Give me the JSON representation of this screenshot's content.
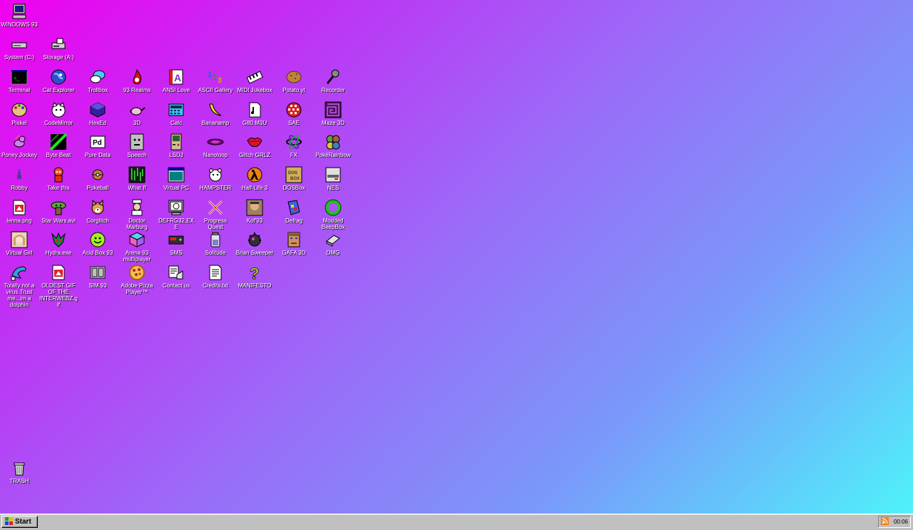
{
  "desktop": {
    "icons": [
      {
        "label": "WINDOWS 93",
        "icon": "computer-icon"
      },
      {
        "label": "System (C:)",
        "icon": "drive-icon"
      },
      {
        "label": "Storage (A:)",
        "icon": "floppy-drive-icon"
      },
      {
        "label": "Terminal",
        "icon": "terminal-icon"
      },
      {
        "label": "Cat Explorer",
        "icon": "globe-icon"
      },
      {
        "label": "Trollbox",
        "icon": "chat-bubble-icon"
      },
      {
        "label": "93 Realms",
        "icon": "flame-icon"
      },
      {
        "label": "ANSI Love",
        "icon": "ansi-letter-icon"
      },
      {
        "label": "ASCII Gallery",
        "icon": "numbers-icon"
      },
      {
        "label": "MIDI Jukebox",
        "icon": "piano-keys-icon"
      },
      {
        "label": "Potato.yt",
        "icon": "potato-icon"
      },
      {
        "label": "Recorder",
        "icon": "microphone-icon"
      },
      {
        "label": "Piskel",
        "icon": "palette-icon"
      },
      {
        "label": "CodeMirror",
        "icon": "cat-face-icon"
      },
      {
        "label": "HexEd",
        "icon": "cube-icon"
      },
      {
        "label": "3D",
        "icon": "teapot-icon"
      },
      {
        "label": "Calc",
        "icon": "calculator-icon"
      },
      {
        "label": "Bananamp",
        "icon": "banana-icon"
      },
      {
        "label": "G80.M3U",
        "icon": "audio-file-icon"
      },
      {
        "label": "SAE",
        "icon": "amiga-ball-icon"
      },
      {
        "label": "Maze 3D",
        "icon": "maze-icon"
      },
      {
        "label": "Poney Jockey",
        "icon": "pony-icon"
      },
      {
        "label": "Byte Beat",
        "icon": "waveform-icon"
      },
      {
        "label": "Pure Data",
        "icon": "pd-icon"
      },
      {
        "label": "Speech",
        "icon": "face-icon"
      },
      {
        "label": "LSDJ",
        "icon": "gameboy-icon"
      },
      {
        "label": "Nanoloop",
        "icon": "disc-icon"
      },
      {
        "label": "Glitch GRLZ",
        "icon": "lips-icon"
      },
      {
        "label": "FX",
        "icon": "atom-icon"
      },
      {
        "label": "PokéRainbow",
        "icon": "pokemon-icon"
      },
      {
        "label": "Robby",
        "icon": "robot-icon"
      },
      {
        "label": "Take this",
        "icon": "character-icon"
      },
      {
        "label": "Pokeball",
        "icon": "pokeball-icon"
      },
      {
        "label": "What If",
        "icon": "matrix-icon"
      },
      {
        "label": "Virtual PC",
        "icon": "window-icon"
      },
      {
        "label": "HAMPSTER",
        "icon": "hamster-icon"
      },
      {
        "label": "Half-Life 3",
        "icon": "lambda-icon"
      },
      {
        "label": "DOSBox",
        "icon": "dosbox-icon"
      },
      {
        "label": "NES",
        "icon": "nes-icon"
      },
      {
        "label": "lenna.png",
        "icon": "image-file-icon"
      },
      {
        "label": "Star Wars.avi",
        "icon": "yoda-icon"
      },
      {
        "label": "Corglitch",
        "icon": "corgi-icon"
      },
      {
        "label": "Doctor Marburg",
        "icon": "doctor-icon"
      },
      {
        "label": "DEFRG32.EXE",
        "icon": "defrag-monitor-icon"
      },
      {
        "label": "Progress Quest",
        "icon": "crossed-swords-icon"
      },
      {
        "label": "Kof'93",
        "icon": "fighter-icon"
      },
      {
        "label": "Defrag",
        "icon": "defrag-icon"
      },
      {
        "label": "Modded BeepBox",
        "icon": "green-ring-icon"
      },
      {
        "label": "Virtual Girl",
        "icon": "girl-icon"
      },
      {
        "label": "Hydra.exe",
        "icon": "hydra-icon"
      },
      {
        "label": "Acid Box 93",
        "icon": "smiley-icon"
      },
      {
        "label": "Arena 93 multiplayer",
        "icon": "colored-cube-icon"
      },
      {
        "label": "SMS",
        "icon": "cartridge-icon"
      },
      {
        "label": "Solitude",
        "icon": "jar-icon"
      },
      {
        "label": "Brian Sweeper",
        "icon": "bomb-icon"
      },
      {
        "label": "GAFA 3D",
        "icon": "pixel-face-icon"
      },
      {
        "label": "DMG",
        "icon": "eraser-icon"
      },
      {
        "label": "Totally not a virus.Trust me...im a dolphin",
        "icon": "dolphin-icon"
      },
      {
        "label": "OLDEST GIF OF THE INTERWEBZ.gif",
        "icon": "gif-file-icon"
      },
      {
        "label": "SIM 93",
        "icon": "sim-icon"
      },
      {
        "label": "Adobe Pizza Player™",
        "icon": "pizza-icon"
      },
      {
        "label": "Contact us",
        "icon": "contact-icon"
      },
      {
        "label": "Credits.txt",
        "icon": "text-file-icon"
      },
      {
        "label": "MANIFESTO",
        "icon": "question-mark-icon"
      },
      {
        "label": "TRASH",
        "icon": "trash-icon"
      }
    ]
  },
  "taskbar": {
    "start_label": "Start",
    "clock": "00:06"
  }
}
